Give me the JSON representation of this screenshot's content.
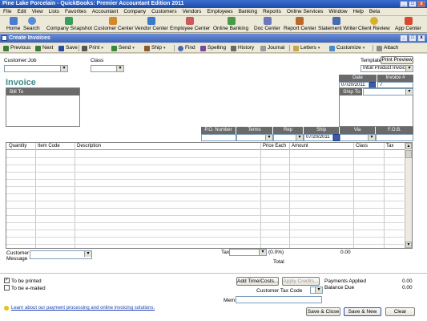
{
  "app": {
    "title": "Pine Lake Porcelain  -  QuickBooks: Premier Accountant Edition 2011",
    "window_controls": [
      "_",
      "□",
      "x"
    ]
  },
  "menu": [
    "File",
    "Edit",
    "View",
    "Lists",
    "Favorites",
    "Accountant",
    "Company",
    "Customers",
    "Vendors",
    "Employees",
    "Banking",
    "Reports",
    "Online Services",
    "Window",
    "Help",
    "Beta"
  ],
  "iconbar": [
    {
      "label": "Home",
      "icon": "home-icon",
      "color": "#4a7bd0"
    },
    {
      "label": "Search",
      "icon": "search-icon",
      "color": "#5a8ad8"
    },
    {
      "label": "Company Snapshot",
      "icon": "snapshot-icon",
      "color": "#3c9c5a"
    },
    {
      "label": "Customer Center",
      "icon": "customer-icon",
      "color": "#d48a2a"
    },
    {
      "label": "Vendor Center",
      "icon": "vendor-icon",
      "color": "#3a7ac8"
    },
    {
      "label": "Employee Center",
      "icon": "employee-icon",
      "color": "#c85a5a"
    },
    {
      "label": "Online Banking",
      "icon": "bank-icon",
      "color": "#4a9a4a"
    },
    {
      "label": "Doc Center",
      "icon": "document-icon",
      "color": "#6a7ab8"
    },
    {
      "label": "Report Center",
      "icon": "report-icon",
      "color": "#b86a2a"
    },
    {
      "label": "Statement Writer",
      "icon": "statement-icon",
      "color": "#4a6ab0"
    },
    {
      "label": "Client Review",
      "icon": "review-icon",
      "color": "#d8b02a"
    },
    {
      "label": "App Center",
      "icon": "app-icon",
      "color": "#d84a2a"
    }
  ],
  "window": {
    "title": "Create Invoices",
    "controls": [
      "_",
      "□",
      "x"
    ]
  },
  "toolbar": {
    "previous": "Previous",
    "next": "Next",
    "save": "Save",
    "print": "Print",
    "send": "Send",
    "ship": "Ship",
    "find": "Find",
    "spelling": "Spelling",
    "history": "History",
    "journal": "Journal",
    "letters": "Letters",
    "customize": "Customize",
    "attach": "Attach"
  },
  "header": {
    "customer_job_label": "Customer:Job",
    "class_label": "Class",
    "template_label": "Template",
    "print_preview": "Print Preview",
    "template_value": "Intuit Product Invoice",
    "invoice_title": "Invoice",
    "date_label": "Date",
    "date_value": "07/20/2011",
    "invoice_no_label": "Invoice #",
    "invoice_no_value": "7",
    "bill_to_label": "Bill To",
    "ship_to_label": "Ship To"
  },
  "shipping": {
    "po_label": "P.O. Number",
    "terms_label": "Terms",
    "rep_label": "Rep",
    "ship_label": "Ship",
    "ship_value": "07/20/2011",
    "via_label": "Via",
    "fob_label": "F.O.B."
  },
  "grid": {
    "columns": [
      "Quantity",
      "Item Code",
      "Description",
      "Price Each",
      "Amount",
      "Class",
      "Tax"
    ],
    "rows": 13
  },
  "footer": {
    "customer_message_label": "Customer Message",
    "tax_label": "Tax",
    "tax_rate": "(0.0%)",
    "tax_amount": "0.00",
    "total_label": "Total",
    "to_be_printed": "To be printed",
    "to_be_emailed": "To be e-mailed",
    "add_time_costs": "Add Time/Costs...",
    "apply_credits": "Apply Credits...",
    "payments_applied_label": "Payments Applied",
    "payments_applied_value": "0.00",
    "balance_due_label": "Balance Due",
    "balance_due_value": "0.00",
    "customer_tax_code_label": "Customer Tax Code",
    "memo_label": "Memo",
    "link_text": "Learn about our payment processing and online invoicing solutions.",
    "save_close": "Save & Close",
    "save_new": "Save & New",
    "clear": "Clear"
  }
}
